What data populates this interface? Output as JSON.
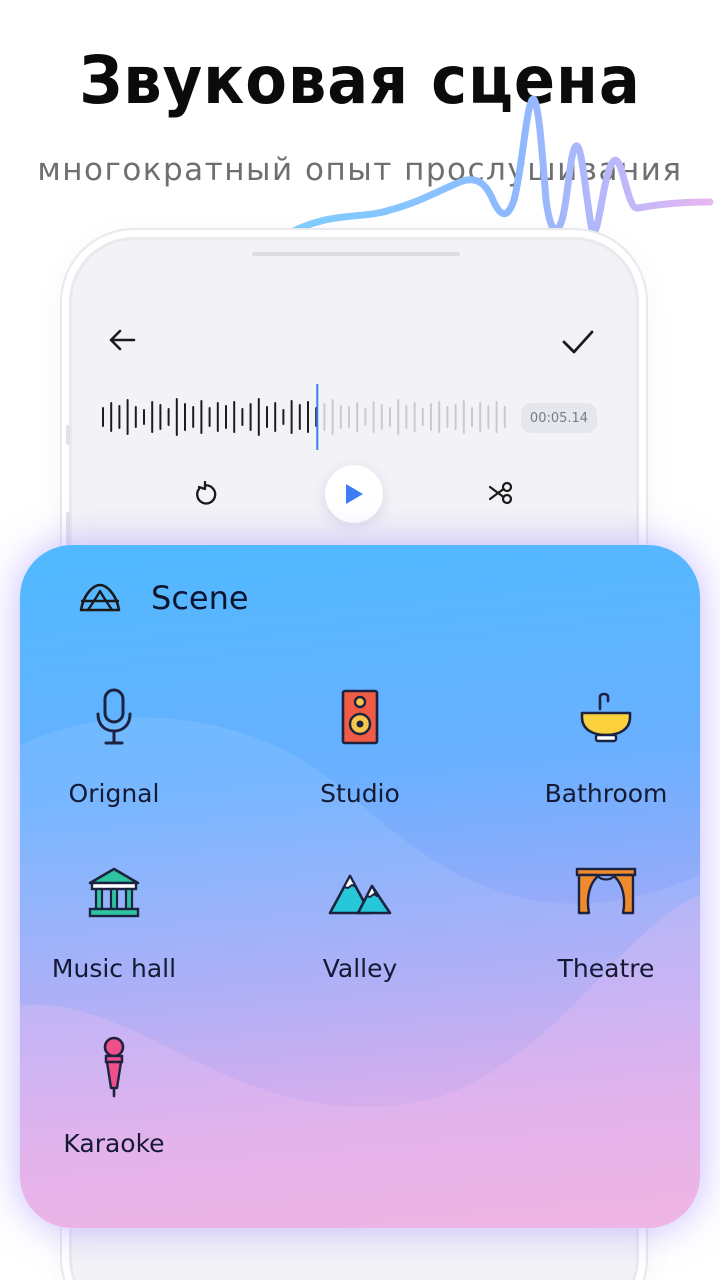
{
  "headline": "Звуковая сцена",
  "subheadline": "многократный опыт прослушивания",
  "editor": {
    "time": "00:05.14",
    "accent_color": "#3d7cf5",
    "waveform_progress": 0.53
  },
  "scene_panel": {
    "title": "Scene",
    "items": [
      {
        "label": "Orignal",
        "icon": "microphone-icon"
      },
      {
        "label": "Studio",
        "icon": "speaker-icon"
      },
      {
        "label": "Bathroom",
        "icon": "sink-icon"
      },
      {
        "label": "Music hall",
        "icon": "music-hall-building-icon"
      },
      {
        "label": "Valley",
        "icon": "mountains-icon"
      },
      {
        "label": "Theatre",
        "icon": "stage-curtain-icon"
      },
      {
        "label": "Karaoke",
        "icon": "karaoke-microphone-icon"
      }
    ]
  }
}
